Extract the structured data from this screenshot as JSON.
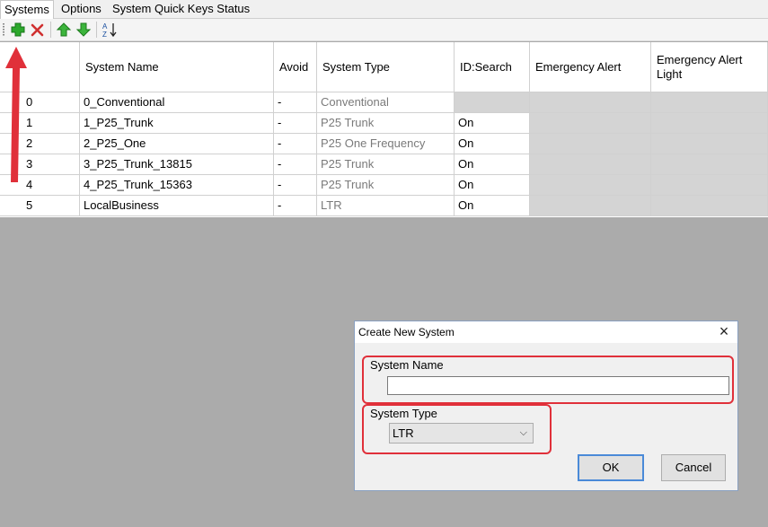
{
  "tabs": [
    {
      "label": "Systems",
      "active": true
    },
    {
      "label": "Options",
      "active": false
    },
    {
      "label": "System Quick Keys Status",
      "active": false
    }
  ],
  "toolbar": {
    "buttons": [
      "add-icon",
      "delete-icon",
      "move-up-icon",
      "move-down-icon",
      "sort-az-icon"
    ],
    "add_color": "#2ca82c",
    "delete_color": "#d03030"
  },
  "table": {
    "columns": [
      "",
      "System Name",
      "Avoid",
      "System Type",
      "ID:Search",
      "Emergency Alert",
      "Emergency Alert Light"
    ],
    "rows": [
      {
        "index": "0",
        "name": "0_Conventional",
        "avoid": "-",
        "type": "Conventional",
        "id_search": ""
      },
      {
        "index": "1",
        "name": "1_P25_Trunk",
        "avoid": "-",
        "type": "P25 Trunk",
        "id_search": "On"
      },
      {
        "index": "2",
        "name": "2_P25_One",
        "avoid": "-",
        "type": "P25 One Frequency",
        "id_search": "On"
      },
      {
        "index": "3",
        "name": "3_P25_Trunk_13815",
        "avoid": "-",
        "type": "P25 Trunk",
        "id_search": "On"
      },
      {
        "index": "4",
        "name": "4_P25_Trunk_15363",
        "avoid": "-",
        "type": "P25 Trunk",
        "id_search": "On"
      },
      {
        "index": "5",
        "name": "LocalBusiness",
        "avoid": "-",
        "type": "LTR",
        "id_search": "On"
      }
    ]
  },
  "dialog": {
    "title": "Create New System",
    "system_name_label": "System Name",
    "system_name_value": "",
    "system_type_label": "System Type",
    "system_type_value": "LTR",
    "ok_label": "OK",
    "cancel_label": "Cancel"
  },
  "annotation_color": "#e0303a"
}
